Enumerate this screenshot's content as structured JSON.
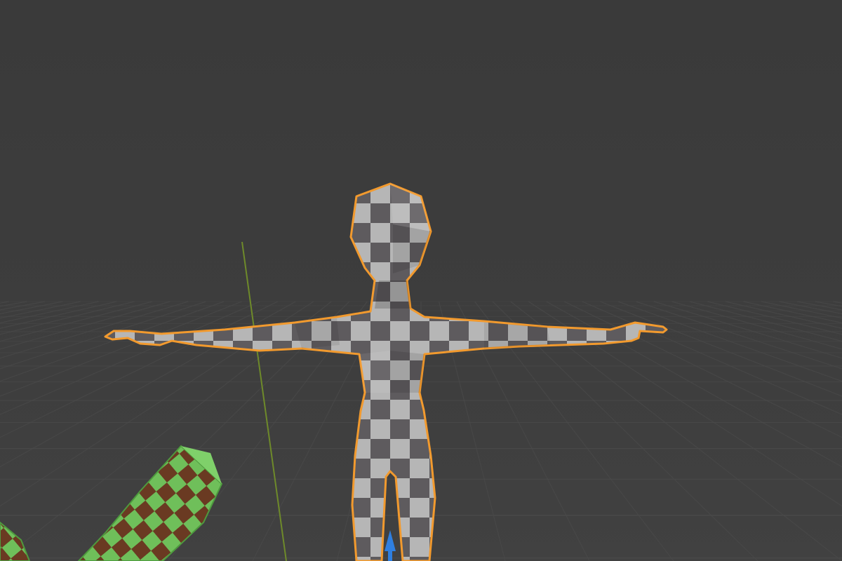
{
  "app": {
    "context": "3d-viewport"
  },
  "viewport": {
    "background_color": "#3d3d3d",
    "grid_color": "#4a4a4a",
    "y_axis_color": "#6e8a2a",
    "selection_outline_color": "#f29a2e",
    "origin_marker_color": "#2f7fe0"
  },
  "objects": [
    {
      "id": "character",
      "type": "mesh",
      "selected": true,
      "material": "checker",
      "colors": {
        "light": "#b4b4b4",
        "dark": "#5c5a5c"
      }
    },
    {
      "id": "log",
      "type": "mesh",
      "selected": false,
      "material": "checker",
      "colors": {
        "light": "#6fbf5a",
        "dark": "#6a3a22"
      }
    }
  ]
}
